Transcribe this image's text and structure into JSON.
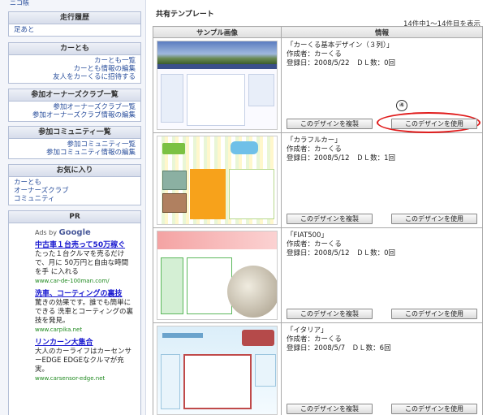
{
  "sidebar": {
    "top_link": "ニコ帳",
    "history": {
      "title": "走行履歴",
      "items": [
        "足あと"
      ]
    },
    "cartomo": {
      "title": "カーとも",
      "items": [
        "カーとも一覧",
        "カーとも情報の編集",
        "友人をカーくるに招待する"
      ]
    },
    "owners": {
      "title": "参加オーナーズクラブ一覧",
      "items": [
        "参加オーナーズクラブ一覧",
        "参加オーナーズクラブ情報の編集"
      ]
    },
    "community": {
      "title": "参加コミュニティ一覧",
      "items": [
        "参加コミュニティ一覧",
        "参加コミュニティ情報の編集"
      ]
    },
    "favorites": {
      "title": "お気に入り",
      "items": [
        "カーとも",
        "オーナーズクラブ",
        "コミュニティ"
      ]
    },
    "pr": {
      "title": "PR",
      "ads_by": "Ads by",
      "google": "Google",
      "ads": [
        {
          "title": "中古車１台売って50万稼ぐ",
          "text": "たった１台クルマを売るだけで、月に 50万円と自由な時間を手 に入れる",
          "url": "www.car-de-100man.com/"
        },
        {
          "title": "洗車、コーティングの裏技",
          "text": "驚きの効果です。誰でも簡単にできる 洗車とコーティングの裏技を発見。",
          "url": "www.carpika.net"
        },
        {
          "title": "リンカーン大集合",
          "text": "大人のカーライフはカーセンサーEDGE EDGEなクルマが充実。",
          "url": "www.carsensor-edge.net"
        }
      ]
    }
  },
  "main": {
    "section_title": "共有テンプレート",
    "count": "14件中1～14件目を表示",
    "columns": [
      "サンプル画像",
      "情報"
    ],
    "copy_label": "このデザインを複製",
    "use_label": "このデザインを使用",
    "marker": "④",
    "rows": [
      {
        "name": "「カーくる基本デザイン（３列）」",
        "author": "作成者：カーくる",
        "meta": "登録日：2008/5/22　ＤＬ数：0回"
      },
      {
        "name": "「カラフルカー」",
        "author": "作成者：カーくる",
        "meta": "登録日：2008/5/12　ＤＬ数：1回"
      },
      {
        "name": "「FIAT500」",
        "author": "作成者：カーくる",
        "meta": "登録日：2008/5/12　ＤＬ数：0回"
      },
      {
        "name": "「イタリア」",
        "author": "作成者：カーくる",
        "meta": "登録日：2008/5/7　ＤＬ数：6回"
      }
    ]
  },
  "colors": {
    "link": "#2a4f9c",
    "highlight": "#e01b1b",
    "ad_title": "#1a1ad0",
    "ad_url": "#208a20"
  }
}
